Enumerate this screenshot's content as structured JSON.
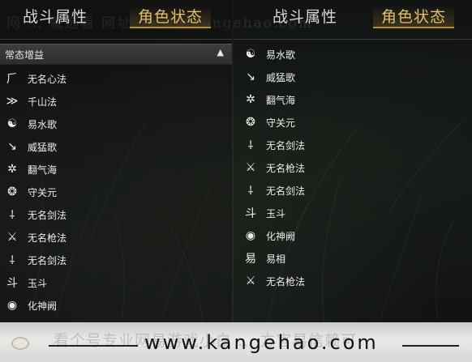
{
  "watermark_top": "网 … 就选看 网址：www.kangehao.com",
  "left_panel": {
    "tabs": [
      {
        "label": "战斗属性",
        "active": false
      },
      {
        "label": "角色状态",
        "active": true
      }
    ],
    "section_header": "常态增益",
    "collapse_icon": "triangle-up-icon",
    "items": [
      {
        "icon": "无名心法-icon",
        "label": "无名心法"
      },
      {
        "icon": "千山法-icon",
        "label": "千山法"
      },
      {
        "icon": "易水歌-icon",
        "label": "易水歌"
      },
      {
        "icon": "威猛歌-icon",
        "label": "威猛歌"
      },
      {
        "icon": "翻气海-icon",
        "label": "翻气海"
      },
      {
        "icon": "守关元-icon",
        "label": "守关元"
      },
      {
        "icon": "无名剑法-icon",
        "label": "无名剑法"
      },
      {
        "icon": "无名枪法-icon",
        "label": "无名枪法"
      },
      {
        "icon": "无名剑法-icon",
        "label": "无名剑法"
      },
      {
        "icon": "玉斗-icon",
        "label": "玉斗"
      },
      {
        "icon": "化神阙-icon",
        "label": "化神阙"
      }
    ]
  },
  "right_panel": {
    "tabs": [
      {
        "label": "战斗属性",
        "active": false
      },
      {
        "label": "角色状态",
        "active": true
      }
    ],
    "items": [
      {
        "icon": "易水歌-icon",
        "label": "易水歌"
      },
      {
        "icon": "威猛歌-icon",
        "label": "威猛歌"
      },
      {
        "icon": "翻气海-icon",
        "label": "翻气海"
      },
      {
        "icon": "守关元-icon",
        "label": "守关元"
      },
      {
        "icon": "无名剑法-icon",
        "label": "无名剑法"
      },
      {
        "icon": "无名枪法-icon",
        "label": "无名枪法"
      },
      {
        "icon": "无名剑法-icon",
        "label": "无名剑法"
      },
      {
        "icon": "玉斗-icon",
        "label": "玉斗"
      },
      {
        "icon": "化神阙-icon",
        "label": "化神阙"
      },
      {
        "icon": "易相-icon",
        "label": "易相"
      },
      {
        "icon": "无名枪法-icon",
        "label": "无名枪法"
      }
    ]
  },
  "bottom_banner": {
    "ghost_text": "看个号专业网易游戏小白 … 方官易信赖可",
    "site": "www.kangehao.com"
  },
  "colors": {
    "active_tab": "#e4bf6a",
    "text": "#ededea",
    "header_bg": "#363736"
  }
}
